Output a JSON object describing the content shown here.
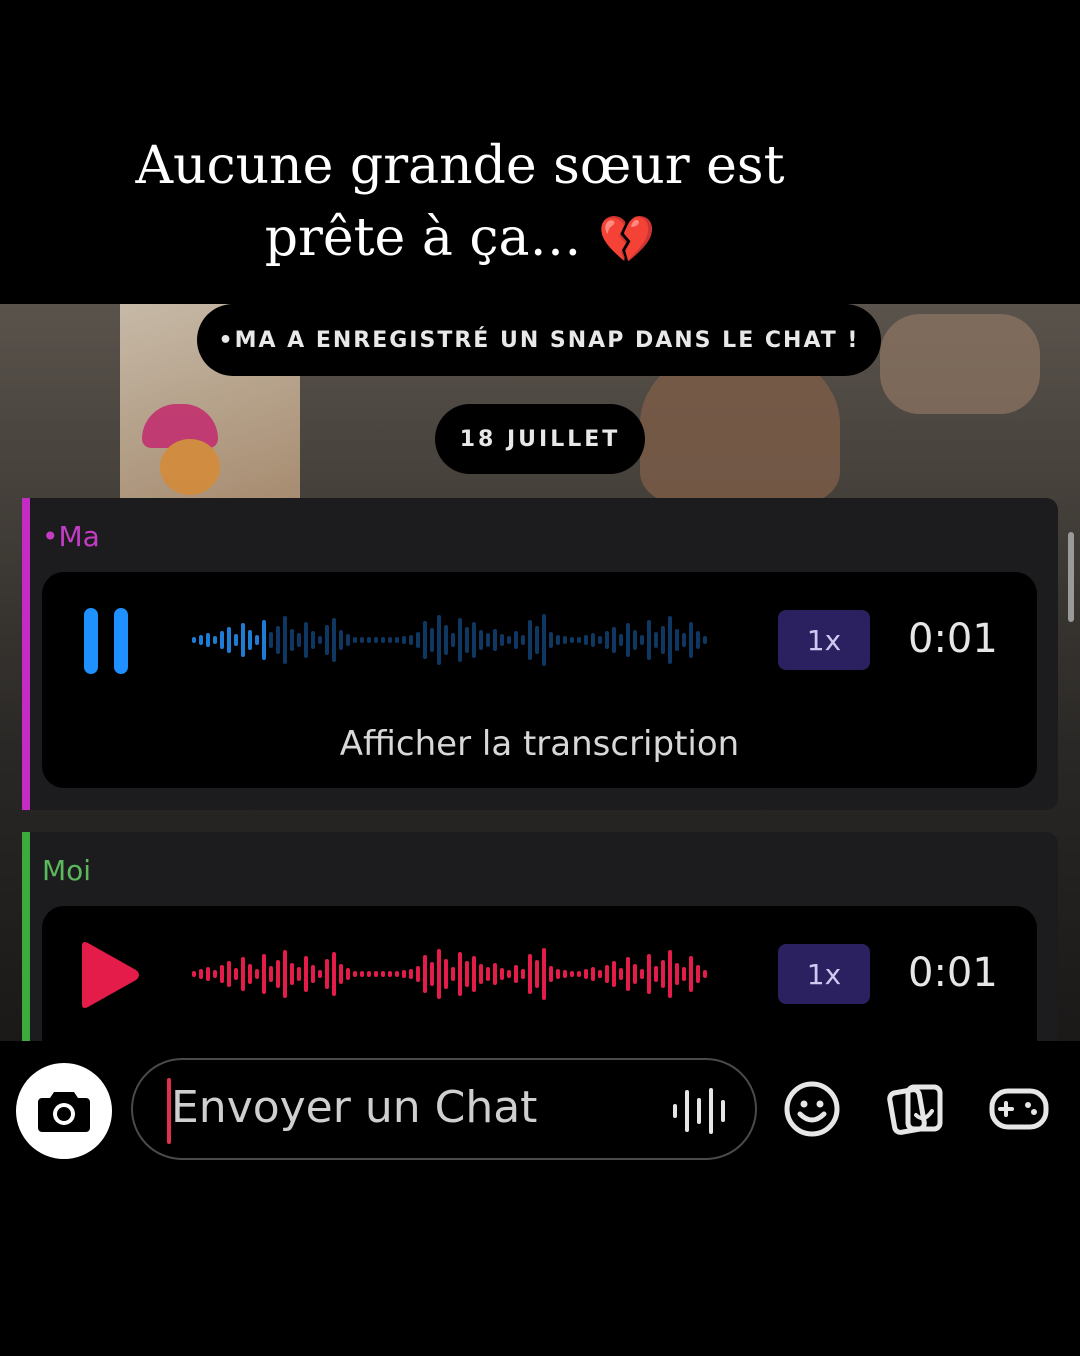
{
  "caption": {
    "text": "Aucune grande sœur est prête à ça…",
    "emoji": "💔"
  },
  "chat": {
    "system_notice": "•MA A ENREGISTRÉ UN SNAP DANS LE CHAT !",
    "date": "18 JUILLET",
    "messages": [
      {
        "sender": "•Ma",
        "sender_color": "#c43cc4",
        "bar_color": "#c42ac4",
        "state": "playing",
        "control_icon": "pause-icon",
        "wave_color": "#1e7bd6",
        "speed": "1x",
        "duration": "0:01",
        "transcript_link": "Afficher la transcription"
      },
      {
        "sender": "Moi",
        "sender_color": "#5cb85c",
        "bar_color": "#3cab3c",
        "state": "paused",
        "control_icon": "play-icon",
        "wave_color": "#e31c4a",
        "speed": "1x",
        "duration": "0:01"
      }
    ]
  },
  "composer": {
    "placeholder": "Envoyer un Chat",
    "icons": [
      "camera-icon",
      "voice-note-icon",
      "emoji-icon",
      "stickers-icon",
      "games-icon"
    ]
  }
}
